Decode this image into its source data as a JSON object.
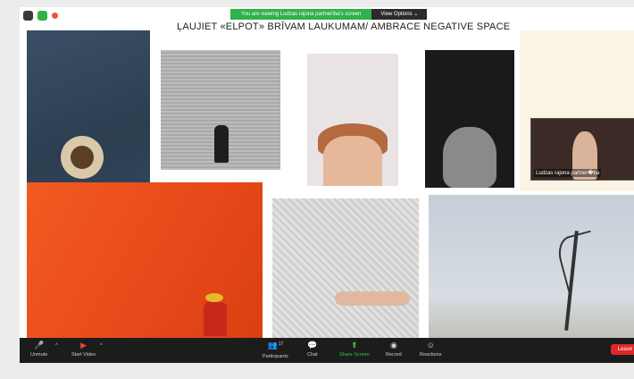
{
  "banner": {
    "message": "You are viewing Ludzas rajona partnerība's screen",
    "view_options": "View Options ⌄"
  },
  "slide": {
    "title": "ĻAUJIET «ELPOT» BRĪVAM LAUKUMAM/ AMBRACE NEGATIVE SPACE"
  },
  "self_view": {
    "name": "Ludzas rajona partner�ba"
  },
  "toolbar": {
    "unmute": "Unmute",
    "start_video": "Start Video",
    "participants": "Participants",
    "participants_count": "17",
    "chat": "Chat",
    "share_screen": "Share Screen",
    "record": "Record",
    "reactions": "Reactions",
    "leave": "Leave"
  },
  "icons": {
    "mic": "mic-muted-icon",
    "video": "video-off-icon",
    "participants": "participants-icon",
    "chat": "chat-icon",
    "share": "share-screen-icon",
    "record": "record-icon",
    "reactions": "reactions-icon"
  },
  "colors": {
    "share_green": "#33c24d",
    "leave_red": "#e02828",
    "banner_green": "#2fb24a",
    "toolbar_bg": "#1c1c1c"
  }
}
